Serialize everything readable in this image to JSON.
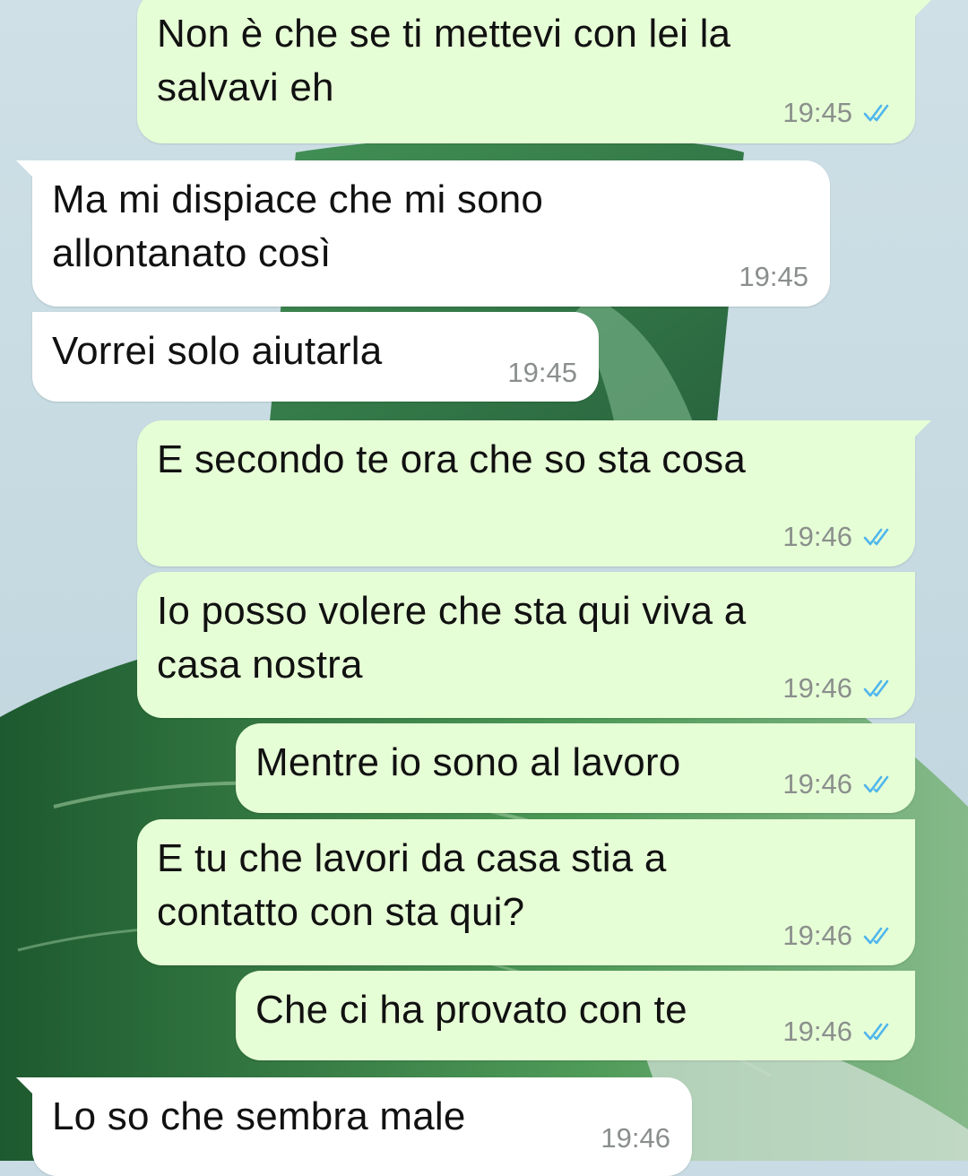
{
  "chat": {
    "messages": [
      {
        "dir": "out",
        "text": "Non è che se ti mettevi con lei la\nsalvavi eh",
        "time": "19:45",
        "status": "read"
      },
      {
        "dir": "in",
        "text": "Ma mi dispiace che mi sono\nallontanato così",
        "time": "19:45"
      },
      {
        "dir": "in",
        "text": "Vorrei solo aiutarla",
        "time": "19:45"
      },
      {
        "dir": "out",
        "text": "E secondo te ora che so sta cosa",
        "time": "19:46",
        "status": "read"
      },
      {
        "dir": "out",
        "text": "Io posso volere che sta qui viva a\ncasa nostra",
        "time": "19:46",
        "status": "read"
      },
      {
        "dir": "out",
        "text": "Mentre io sono al lavoro",
        "time": "19:46",
        "status": "read"
      },
      {
        "dir": "out",
        "text": "E tu che lavori da casa stia a\ncontatto con sta qui?",
        "time": "19:46",
        "status": "read"
      },
      {
        "dir": "out",
        "text": "Che ci ha provato con te",
        "time": "19:46",
        "status": "read"
      },
      {
        "dir": "in",
        "text": "Lo so che sembra male",
        "time": "19:46"
      }
    ]
  },
  "colors": {
    "outgoing_bubble": "#e6fed6",
    "incoming_bubble": "#ffffff",
    "read_ticks": "#4fb6ec",
    "time_text": "#8a8f8c",
    "wallpaper": "#c9dbe4"
  },
  "icons": {
    "read_receipt": "double-check-icon"
  }
}
